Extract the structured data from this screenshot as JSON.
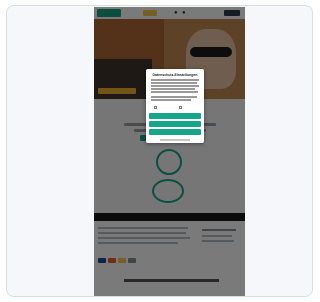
{
  "site": {
    "logo_text": "",
    "brand_color": "#17a589",
    "hero_title": "",
    "icons": [
      "search-icon",
      "account-icon",
      "cart-icon",
      "menu-icon"
    ]
  },
  "consent": {
    "title": "Datenschutz-Einstellungen",
    "option_left_label": "",
    "option_right_label": "",
    "accept_all_label": "",
    "save_label": "",
    "deny_label": ""
  },
  "colors": {
    "accent": "#17a589",
    "overlay": "rgba(0,0,0,0.52)",
    "promo": "#f2c94c",
    "hero_cta": "#f2b134"
  }
}
